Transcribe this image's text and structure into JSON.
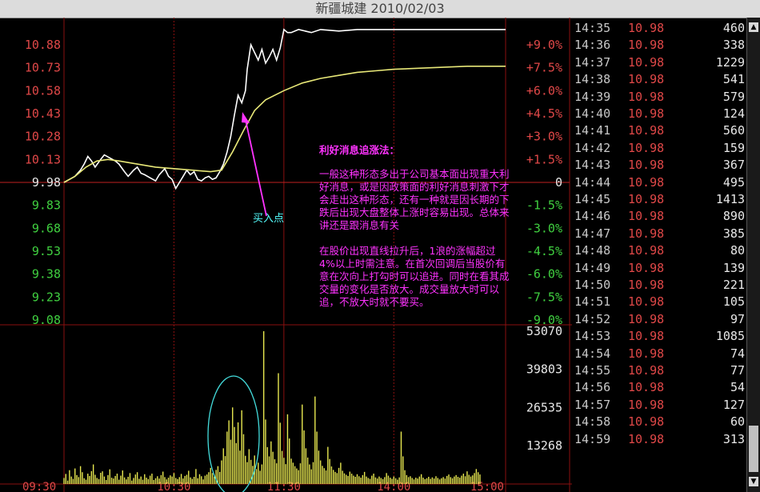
{
  "window": {
    "title": "新疆城建  2010/02/03"
  },
  "annotation": {
    "heading": "利好消息追涨法：",
    "paragraph1": "一般这种形态多出于公司基本面出现重大利好消息，或是因政策面的利好消息刺激下才会走出这种形态，还有一种就是因长期的下跌后出现大盘整体上涨时容易出现。总体来讲还是跟消息有关",
    "paragraph2": "在股价出现直线拉升后，1浪的涨幅超过4%以上时需注意。在首次回调后当股价有意在次向上打勾时可以追进。同时在看其成交量的变化是否放大。成交量放大时可以追，不放大时就不要买。",
    "buy_point_label": "买入点"
  },
  "chart_data": {
    "type": "line",
    "title": "",
    "price_axis_left": [
      "10.88",
      "10.73",
      "10.58",
      "10.43",
      "10.28",
      "10.13",
      "9.98",
      "9.83",
      "9.68",
      "9.53",
      "9.38",
      "9.23",
      "9.08"
    ],
    "percent_axis_right": [
      "+9.0%",
      "+7.5%",
      "+6.0%",
      "+4.5%",
      "+3.0%",
      "+1.5%",
      "0",
      "-1.5%",
      "-3.0%",
      "-4.5%",
      "-6.0%",
      "-7.5%",
      "-9.0%"
    ],
    "volume_axis": [
      "53070",
      "39803",
      "26535",
      "13268"
    ],
    "time_labels": [
      "09:30",
      "10:30",
      "11:30",
      "14:00",
      "15:00"
    ],
    "prev_close": 9.98,
    "ylim": [
      9.08,
      10.88
    ],
    "volume_max": 53070,
    "series": [
      {
        "key": "price",
        "color": "#ffffff",
        "points": [
          [
            0,
            9.98
          ],
          [
            3,
            10.0
          ],
          [
            6,
            10.02
          ],
          [
            9,
            10.06
          ],
          [
            11,
            10.1
          ],
          [
            13,
            10.15
          ],
          [
            15,
            10.12
          ],
          [
            17,
            10.08
          ],
          [
            20,
            10.13
          ],
          [
            22,
            10.16
          ],
          [
            25,
            10.14
          ],
          [
            28,
            10.12
          ],
          [
            30,
            10.1
          ],
          [
            33,
            10.05
          ],
          [
            35,
            10.02
          ],
          [
            38,
            10.06
          ],
          [
            40,
            10.08
          ],
          [
            42,
            10.04
          ],
          [
            44,
            10.03
          ],
          [
            47,
            10.01
          ],
          [
            50,
            9.99
          ],
          [
            52,
            10.03
          ],
          [
            55,
            10.07
          ],
          [
            57,
            10.02
          ],
          [
            59,
            10.0
          ],
          [
            61,
            9.94
          ],
          [
            63,
            9.98
          ],
          [
            65,
            10.02
          ],
          [
            67,
            10.06
          ],
          [
            69,
            10.03
          ],
          [
            71,
            10.05
          ],
          [
            73,
            10.0
          ],
          [
            75,
            9.99
          ],
          [
            77,
            10.01
          ],
          [
            79,
            10.02
          ],
          [
            81,
            10.0
          ],
          [
            83,
            10.01
          ],
          [
            85,
            10.05
          ],
          [
            87,
            10.1
          ],
          [
            89,
            10.18
          ],
          [
            91,
            10.28
          ],
          [
            93,
            10.42
          ],
          [
            95,
            10.55
          ],
          [
            97,
            10.5
          ],
          [
            99,
            10.58
          ],
          [
            100,
            10.72
          ],
          [
            102,
            10.88
          ],
          [
            104,
            10.83
          ],
          [
            106,
            10.78
          ],
          [
            108,
            10.85
          ],
          [
            110,
            10.76
          ],
          [
            112,
            10.8
          ],
          [
            114,
            10.85
          ],
          [
            116,
            10.78
          ],
          [
            118,
            10.86
          ],
          [
            120,
            10.98
          ],
          [
            122,
            10.96
          ],
          [
            124,
            10.96
          ],
          [
            128,
            10.98
          ],
          [
            135,
            10.96
          ],
          [
            140,
            10.98
          ],
          [
            150,
            10.97
          ],
          [
            160,
            10.98
          ],
          [
            170,
            10.98
          ],
          [
            180,
            10.98
          ],
          [
            200,
            10.98
          ],
          [
            220,
            10.98
          ],
          [
            241,
            10.98
          ]
        ]
      },
      {
        "key": "average",
        "color": "#e8e878",
        "points": [
          [
            0,
            9.98
          ],
          [
            6,
            10.02
          ],
          [
            12,
            10.08
          ],
          [
            18,
            10.12
          ],
          [
            24,
            10.13
          ],
          [
            30,
            10.12
          ],
          [
            40,
            10.1
          ],
          [
            50,
            10.08
          ],
          [
            60,
            10.07
          ],
          [
            70,
            10.06
          ],
          [
            80,
            10.05
          ],
          [
            86,
            10.06
          ],
          [
            92,
            10.18
          ],
          [
            98,
            10.32
          ],
          [
            104,
            10.45
          ],
          [
            110,
            10.52
          ],
          [
            120,
            10.58
          ],
          [
            130,
            10.63
          ],
          [
            140,
            10.66
          ],
          [
            150,
            10.68
          ],
          [
            160,
            10.7
          ],
          [
            170,
            10.71
          ],
          [
            180,
            10.72
          ],
          [
            200,
            10.73
          ],
          [
            220,
            10.74
          ],
          [
            241,
            10.74
          ]
        ]
      }
    ],
    "volume": [
      2100,
      3500,
      1200,
      4800,
      2600,
      1800,
      5400,
      3100,
      2400,
      6200,
      4100,
      2000,
      1500,
      3600,
      2800,
      4500,
      6800,
      3200,
      2100,
      1700,
      3900,
      4400,
      2600,
      1400,
      3100,
      5100,
      2200,
      1900,
      2800,
      3600,
      1500,
      2900,
      4700,
      2300,
      1600,
      2500,
      3800,
      1200,
      2100,
      3300,
      4100,
      1800,
      2600,
      1500,
      3400,
      2200,
      1700,
      2900,
      3600,
      1400,
      2000,
      2700,
      1900,
      3100,
      4300,
      2400,
      1600,
      2200,
      3000,
      2600,
      3800,
      2100,
      1700,
      2400,
      3500,
      1900,
      2800,
      3200,
      4600,
      2300,
      1800,
      2500,
      5200,
      2000,
      3400,
      2700,
      1600,
      2900,
      3300,
      4100,
      5600,
      3800,
      2600,
      4900,
      6200,
      4200,
      8200,
      12400,
      9700,
      18200,
      22100,
      15400,
      26600,
      19800,
      14200,
      21400,
      11600,
      25600,
      17300,
      9800,
      7600,
      12100,
      8400,
      6300,
      9900,
      5200,
      7400,
      4600,
      6800,
      53070,
      22400,
      12800,
      9600,
      14800,
      11200,
      8600,
      7200,
      38500,
      21300,
      11500,
      9100,
      6900,
      24200,
      15800,
      8800,
      7400,
      6200,
      5400,
      4800,
      7200,
      27600,
      18600,
      12400,
      9200,
      6800,
      5100,
      7600,
      30400,
      18200,
      11600,
      8200,
      6300,
      5500,
      4700,
      12900,
      8700,
      6100,
      4900,
      4200,
      3800,
      5600,
      7400,
      4600,
      3700,
      3200,
      2800,
      4300,
      3600,
      2900,
      2500,
      3400,
      2700,
      2200,
      3100,
      4200,
      2600,
      2100,
      1800,
      2900,
      3600,
      2300,
      1900,
      2600,
      2100,
      1700,
      2400,
      3800,
      2900,
      2200,
      1800,
      2600,
      2000,
      1500,
      2300,
      18200,
      9600,
      4800,
      3100,
      2400,
      2700,
      2100,
      1600,
      2200,
      1900,
      2600,
      3400,
      2200,
      1700,
      2000,
      2500,
      1800,
      2300,
      1900,
      2700,
      2100,
      1600,
      2000,
      2400,
      1900,
      2800,
      3300,
      2400,
      2000,
      2600,
      3100,
      2500,
      2200,
      2900,
      3600,
      2700,
      4400,
      3200,
      2600,
      3000,
      3800,
      5200,
      4100,
      3300
    ]
  },
  "tick_list": [
    {
      "time": "14:35",
      "price": "10.98",
      "volume": "460"
    },
    {
      "time": "14:36",
      "price": "10.98",
      "volume": "338"
    },
    {
      "time": "14:37",
      "price": "10.98",
      "volume": "1229"
    },
    {
      "time": "14:38",
      "price": "10.98",
      "volume": "541"
    },
    {
      "time": "14:39",
      "price": "10.98",
      "volume": "579"
    },
    {
      "time": "14:40",
      "price": "10.98",
      "volume": "124"
    },
    {
      "time": "14:41",
      "price": "10.98",
      "volume": "560"
    },
    {
      "time": "14:42",
      "price": "10.98",
      "volume": "159"
    },
    {
      "time": "14:43",
      "price": "10.98",
      "volume": "367"
    },
    {
      "time": "14:44",
      "price": "10.98",
      "volume": "495"
    },
    {
      "time": "14:45",
      "price": "10.98",
      "volume": "1413"
    },
    {
      "time": "14:46",
      "price": "10.98",
      "volume": "890"
    },
    {
      "time": "14:47",
      "price": "10.98",
      "volume": "385"
    },
    {
      "time": "14:48",
      "price": "10.98",
      "volume": "80"
    },
    {
      "time": "14:49",
      "price": "10.98",
      "volume": "139"
    },
    {
      "time": "14:50",
      "price": "10.98",
      "volume": "221"
    },
    {
      "time": "14:51",
      "price": "10.98",
      "volume": "105"
    },
    {
      "time": "14:52",
      "price": "10.98",
      "volume": "97"
    },
    {
      "time": "14:53",
      "price": "10.98",
      "volume": "1085"
    },
    {
      "time": "14:54",
      "price": "10.98",
      "volume": "74"
    },
    {
      "time": "14:55",
      "price": "10.98",
      "volume": "77"
    },
    {
      "time": "14:56",
      "price": "10.98",
      "volume": "54"
    },
    {
      "time": "14:57",
      "price": "10.98",
      "volume": "127"
    },
    {
      "time": "14:58",
      "price": "10.98",
      "volume": "60"
    },
    {
      "time": "14:59",
      "price": "10.98",
      "volume": "313"
    }
  ],
  "colors": {
    "up": "#e04848",
    "down": "#40d040",
    "neutral": "#e8e8e8",
    "volume": "#e8e850",
    "grid": "#8a1010"
  }
}
